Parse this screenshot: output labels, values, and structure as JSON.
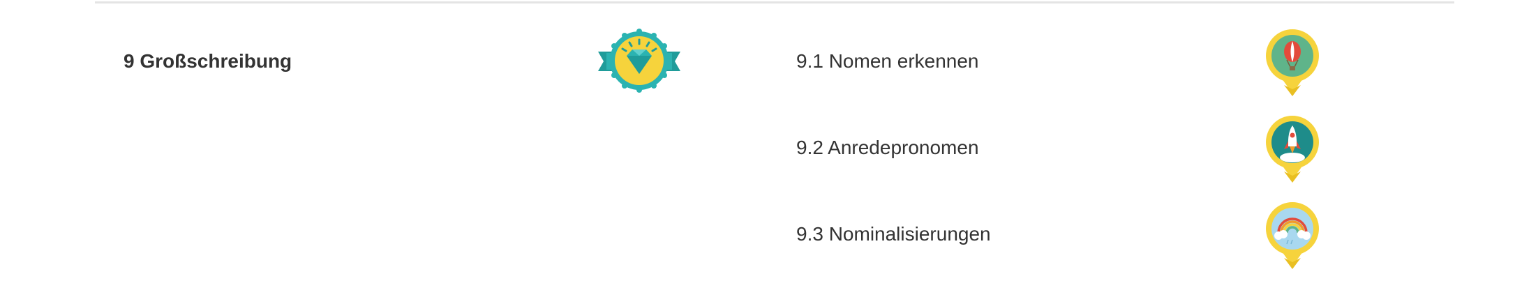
{
  "chapter": {
    "title": "9 Großschreibung",
    "badge_icon": "diamond-ribbon-badge-icon"
  },
  "lessons": [
    {
      "title": "9.1 Nomen erkennen",
      "badge_icon": "hot-air-balloon-medal-icon"
    },
    {
      "title": "9.2 Anredepronomen",
      "badge_icon": "rocket-medal-icon"
    },
    {
      "title": "9.3 Nominalisierungen",
      "badge_icon": "rainbow-medal-icon"
    }
  ],
  "colors": {
    "medal_gold": "#f6d33c",
    "ribbon_teal": "#2bb3b1",
    "text": "#333333",
    "divider": "#e4e4e4"
  }
}
